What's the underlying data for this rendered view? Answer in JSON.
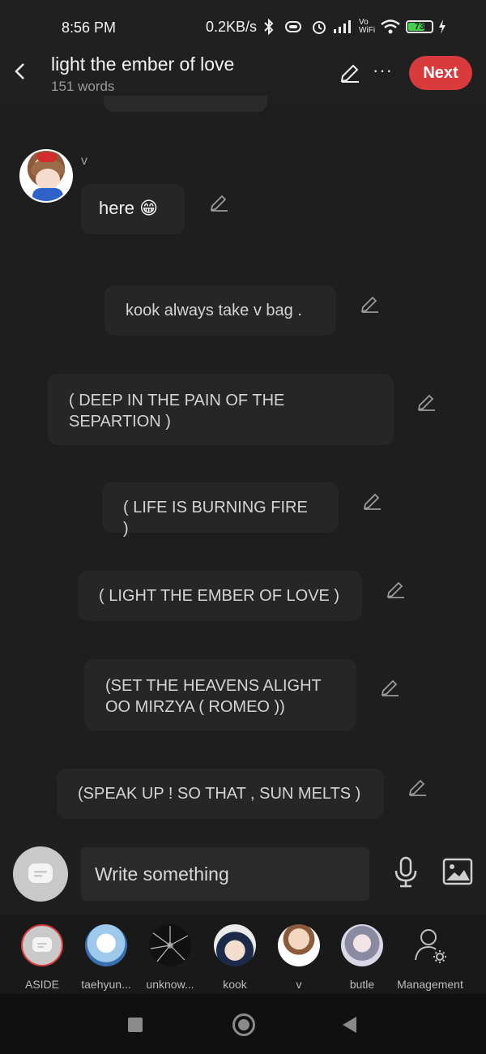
{
  "status_bar": {
    "time": "8:56 PM",
    "speed": "0.2KB/s",
    "battery": "73",
    "battery_level": 0.73,
    "icons": [
      "bluetooth-icon",
      "vibrate-icon",
      "alarm-icon",
      "signal-icon",
      "vowifi-icon",
      "wifi-icon",
      "battery-icon",
      "charging-icon"
    ],
    "vowifi_top": "Vo",
    "vowifi_bottom": "WiFi"
  },
  "header": {
    "title": "light the ember of love",
    "subtitle": "151 words",
    "next_label": "Next",
    "more_label": "···"
  },
  "chat": {
    "sender": "v",
    "first_message": "here 😁",
    "messages": [
      "kook always take v bag .",
      "( DEEP IN THE PAIN OF THE\nSEPARTION )",
      "( LIFE IS BURNING FIRE )",
      "( LIGHT THE EMBER OF LOVE )",
      "(SET THE HEAVENS ALIGHT\nOO MIRZYA ( ROMEO ))",
      "(SPEAK UP ! SO THAT , SUN MELTS )"
    ]
  },
  "composer": {
    "placeholder": "Write something"
  },
  "characters": [
    {
      "label": "ASIDE"
    },
    {
      "label": "taehyun..."
    },
    {
      "label": "unknow..."
    },
    {
      "label": "kook"
    },
    {
      "label": "v"
    },
    {
      "label": "butle"
    },
    {
      "label": "Management"
    }
  ],
  "colors": {
    "accent": "#d93a3c",
    "background": "#1e1e1e",
    "bubble": "#262626"
  }
}
